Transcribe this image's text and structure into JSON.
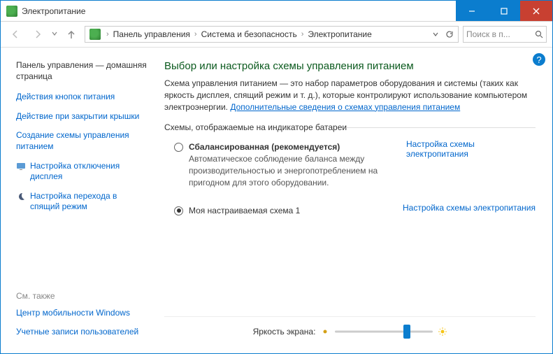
{
  "titlebar": {
    "title": "Электропитание"
  },
  "breadcrumb": {
    "items": [
      "Панель управления",
      "Система и безопасность",
      "Электропитание"
    ]
  },
  "search": {
    "placeholder": "Поиск в п..."
  },
  "sidebar": {
    "home": "Панель управления — домашняя страница",
    "links": [
      "Действия кнопок питания",
      "Действие при закрытии крышки",
      "Создание схемы управления питанием"
    ],
    "icon_links": [
      {
        "icon": "monitor-icon",
        "label": "Настройка отключения дисплея"
      },
      {
        "icon": "moon-icon",
        "label": "Настройка перехода в спящий режим"
      }
    ],
    "see_also": "См. также",
    "footer_links": [
      "Центр мобильности Windows",
      "Учетные записи пользователей"
    ]
  },
  "main": {
    "heading": "Выбор или настройка схемы управления питанием",
    "description_pre": "Схема управления питанием — это набор параметров оборудования и системы (таких как яркость дисплея, спящий режим и т. д.), которые контролируют использование компьютером электроэнергии. ",
    "description_link": "Дополнительные сведения о схемах управления питанием",
    "fieldset": "Схемы, отображаемые на индикаторе батареи",
    "plans": [
      {
        "name": "Сбалансированная (рекомендуется)",
        "desc": "Автоматическое соблюдение баланса между производительностью и энергопотреблением на пригодном для этого оборудовании.",
        "config": "Настройка схемы электропитания",
        "checked": false,
        "bold": true
      },
      {
        "name": "Моя настраиваемая схема 1",
        "desc": "",
        "config": "Настройка схемы электропитания",
        "checked": true,
        "bold": false
      }
    ],
    "brightness_label": "Яркость экрана:"
  }
}
